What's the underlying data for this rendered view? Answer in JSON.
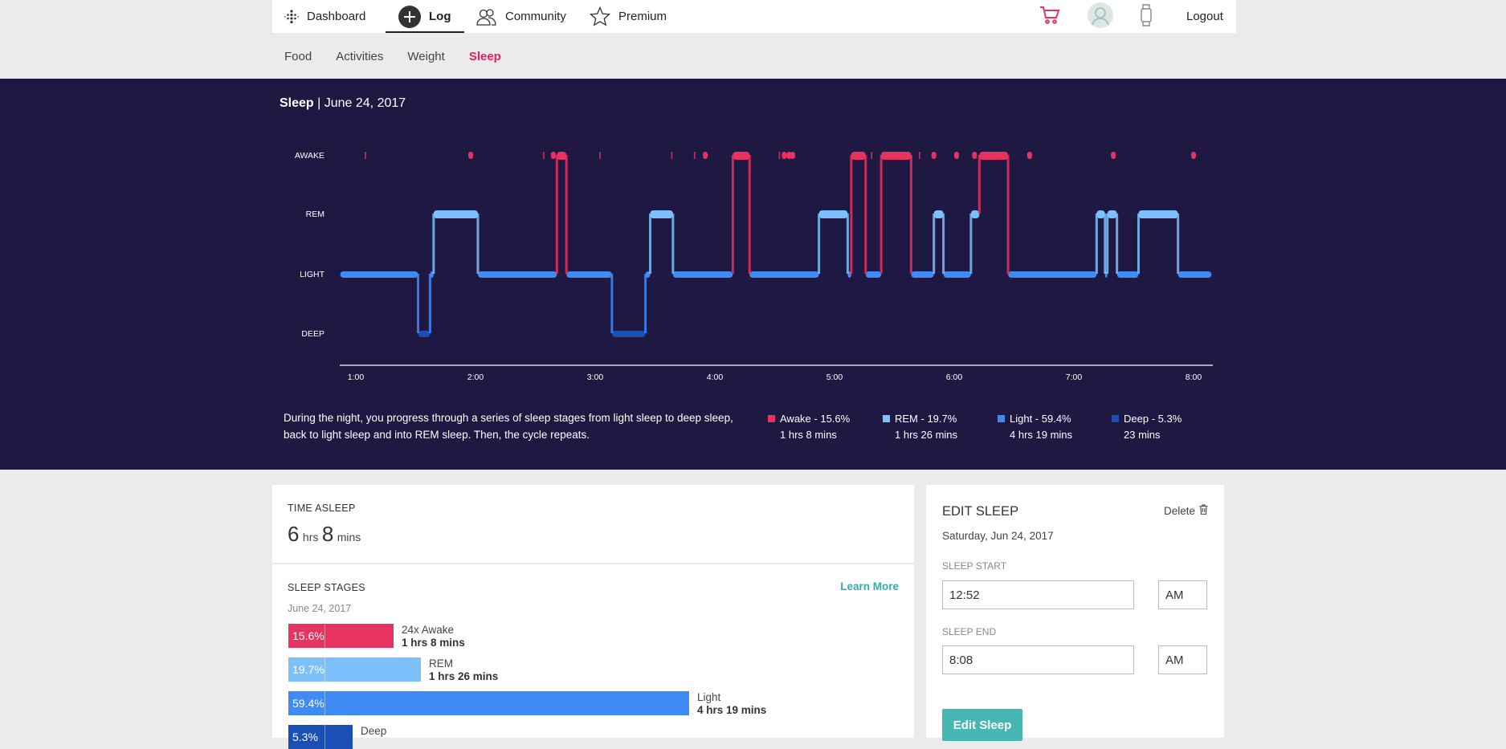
{
  "nav": {
    "dashboard": "Dashboard",
    "log": "Log",
    "community": "Community",
    "premium": "Premium",
    "logout": "Logout"
  },
  "subnav": {
    "food": "Food",
    "activities": "Activities",
    "weight": "Weight",
    "sleep": "Sleep"
  },
  "hero": {
    "title": "Sleep",
    "date": "| June 24, 2017",
    "description": "During the night, you progress through a series of sleep stages from light sleep to deep sleep, back to light sleep and into REM sleep. Then, the cycle repeats.",
    "legend": [
      {
        "label": "Awake - 15.6%",
        "duration": "1 hrs 8 mins",
        "color": "#e8325f"
      },
      {
        "label": "REM - 19.7%",
        "duration": "1 hrs 26 mins",
        "color": "#7cc1fb"
      },
      {
        "label": "Light - 59.4%",
        "duration": "4 hrs 19 mins",
        "color": "#3f8bf6"
      },
      {
        "label": "Deep - 5.3%",
        "duration": "23 mins",
        "color": "#1a4fb5"
      }
    ]
  },
  "chart_data": {
    "type": "line",
    "title": "",
    "stage_labels": [
      "AWAKE",
      "REM",
      "LIGHT",
      "DEEP"
    ],
    "x_ticks": [
      "1:00",
      "2:00",
      "3:00",
      "4:00",
      "5:00",
      "6:00",
      "7:00",
      "8:00"
    ],
    "x_range_hours": [
      0.87,
      8.15
    ],
    "segments": [
      {
        "stage": "LIGHT",
        "start": 0.87,
        "end": 1.52
      },
      {
        "stage": "DEEP",
        "start": 1.52,
        "end": 1.62
      },
      {
        "stage": "LIGHT",
        "start": 1.62,
        "end": 1.65
      },
      {
        "stage": "REM",
        "start": 1.65,
        "end": 2.02
      },
      {
        "stage": "LIGHT",
        "start": 2.02,
        "end": 2.68
      },
      {
        "stage": "AWAKE",
        "start": 2.68,
        "end": 2.76
      },
      {
        "stage": "LIGHT",
        "start": 2.76,
        "end": 3.14
      },
      {
        "stage": "DEEP",
        "start": 3.14,
        "end": 3.42
      },
      {
        "stage": "LIGHT",
        "start": 3.42,
        "end": 3.46
      },
      {
        "stage": "REM",
        "start": 3.46,
        "end": 3.65
      },
      {
        "stage": "LIGHT",
        "start": 3.65,
        "end": 4.15
      },
      {
        "stage": "AWAKE",
        "start": 4.15,
        "end": 4.29
      },
      {
        "stage": "LIGHT",
        "start": 4.29,
        "end": 4.87
      },
      {
        "stage": "REM",
        "start": 4.87,
        "end": 5.11
      },
      {
        "stage": "LIGHT",
        "start": 5.11,
        "end": 5.14
      },
      {
        "stage": "AWAKE",
        "start": 5.14,
        "end": 5.26
      },
      {
        "stage": "LIGHT",
        "start": 5.26,
        "end": 5.39
      },
      {
        "stage": "AWAKE",
        "start": 5.39,
        "end": 5.64
      },
      {
        "stage": "LIGHT",
        "start": 5.64,
        "end": 5.83
      },
      {
        "stage": "REM",
        "start": 5.83,
        "end": 5.91
      },
      {
        "stage": "LIGHT",
        "start": 5.91,
        "end": 6.14
      },
      {
        "stage": "REM",
        "start": 6.14,
        "end": 6.21
      },
      {
        "stage": "AWAKE",
        "start": 6.21,
        "end": 6.45
      },
      {
        "stage": "LIGHT",
        "start": 6.45,
        "end": 7.19
      },
      {
        "stage": "REM",
        "start": 7.19,
        "end": 7.26
      },
      {
        "stage": "LIGHT",
        "start": 7.26,
        "end": 7.28
      },
      {
        "stage": "REM",
        "start": 7.28,
        "end": 7.36
      },
      {
        "stage": "LIGHT",
        "start": 7.36,
        "end": 7.54
      },
      {
        "stage": "REM",
        "start": 7.54,
        "end": 7.87
      },
      {
        "stage": "LIGHT",
        "start": 7.87,
        "end": 8.15
      }
    ],
    "awake_markers": [
      1.96,
      2.65,
      2.72,
      3.92,
      4.58,
      4.62,
      4.65,
      5.58,
      5.83,
      6.02,
      6.17,
      6.63,
      7.33,
      8.0
    ],
    "awake_ticks": [
      1.08,
      2.57,
      2.65,
      3.04,
      3.64,
      3.83,
      4.54,
      5.31,
      5.48,
      5.71
    ]
  },
  "time_asleep": {
    "label": "TIME ASLEEP",
    "hours": "6",
    "hours_unit": "hrs",
    "minutes": "8",
    "minutes_unit": "mins"
  },
  "sleep_stages": {
    "label": "SLEEP STAGES",
    "date": "June 24, 2017",
    "learn_more": "Learn More",
    "bars": [
      {
        "pct": "15.6%",
        "name": "24x Awake",
        "duration": "1 hrs 8 mins",
        "color": "#e8325f",
        "fraction": 0.156
      },
      {
        "pct": "19.7%",
        "name": "REM",
        "duration": "1 hrs 26 mins",
        "color": "#7cc1fb",
        "fraction": 0.197
      },
      {
        "pct": "59.4%",
        "name": "Light",
        "duration": "4 hrs 19 mins",
        "color": "#3f8bf6",
        "fraction": 0.594
      },
      {
        "pct": "5.3%",
        "name": "Deep",
        "duration": "",
        "color": "#1a4fb5",
        "fraction": 0.053
      }
    ]
  },
  "edit_sleep": {
    "title": "EDIT SLEEP",
    "delete": "Delete",
    "date": "Saturday, Jun 24, 2017",
    "start_label": "SLEEP START",
    "start_value": "12:52",
    "start_ampm": "AM",
    "end_label": "SLEEP END",
    "end_value": "8:08",
    "end_ampm": "AM",
    "button": "Edit Sleep"
  }
}
